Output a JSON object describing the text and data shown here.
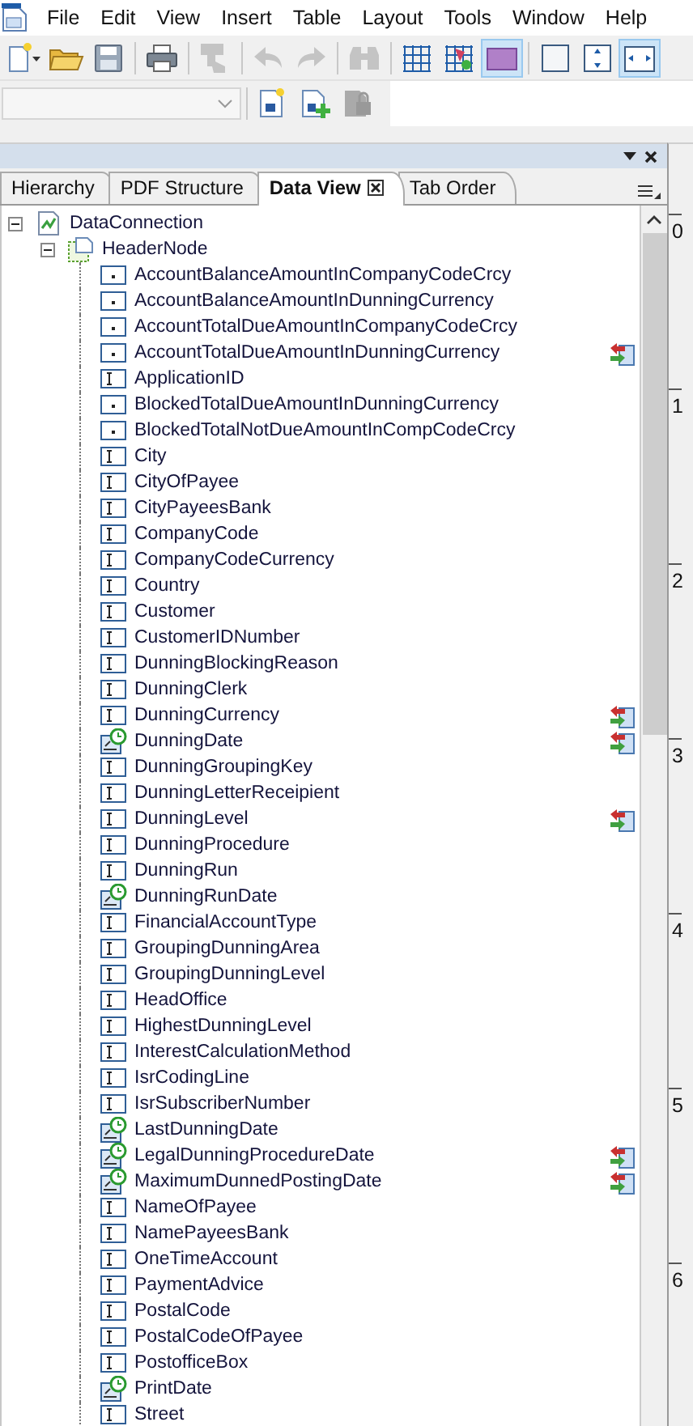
{
  "menu": [
    "File",
    "Edit",
    "View",
    "Insert",
    "Table",
    "Layout",
    "Tools",
    "Window",
    "Help"
  ],
  "toolbar": [
    {
      "kind": "new",
      "selected": false,
      "disabled": false
    },
    {
      "kind": "open",
      "selected": false,
      "disabled": false
    },
    {
      "kind": "save",
      "selected": false,
      "disabled": false
    },
    {
      "kind": "separator"
    },
    {
      "kind": "print",
      "selected": false,
      "disabled": false
    },
    {
      "kind": "separator"
    },
    {
      "kind": "painter",
      "selected": false,
      "disabled": true
    },
    {
      "kind": "separator"
    },
    {
      "kind": "undo",
      "selected": false,
      "disabled": true
    },
    {
      "kind": "redo",
      "selected": false,
      "disabled": true
    },
    {
      "kind": "separator"
    },
    {
      "kind": "find",
      "selected": false,
      "disabled": true
    },
    {
      "kind": "separator"
    },
    {
      "kind": "grid",
      "selected": false,
      "disabled": false
    },
    {
      "kind": "grid-object",
      "selected": false,
      "disabled": false
    },
    {
      "kind": "rectangle",
      "selected": true,
      "disabled": false
    },
    {
      "kind": "separator"
    },
    {
      "kind": "square",
      "selected": false,
      "disabled": false
    },
    {
      "kind": "vertical",
      "selected": false,
      "disabled": false
    },
    {
      "kind": "horizontal",
      "selected": true,
      "disabled": false
    }
  ],
  "toolbar2": [
    {
      "kind": "new-page",
      "disabled": false
    },
    {
      "kind": "add-page",
      "disabled": false
    },
    {
      "kind": "lock",
      "disabled": true
    }
  ],
  "tabs": [
    {
      "label": "Hierarchy",
      "selected": false
    },
    {
      "label": "PDF Structure",
      "selected": false
    },
    {
      "label": "Data View",
      "selected": true
    },
    {
      "label": "Tab Order",
      "selected": false
    }
  ],
  "tree": [
    {
      "label": "DataConnection",
      "kind": "connection",
      "expanded": true,
      "children": [
        {
          "label": "HeaderNode",
          "kind": "group",
          "expanded": true,
          "children": [
            {
              "label": "AccountBalanceAmountInCompanyCodeCrcy",
              "kind": "decimal",
              "bound": false
            },
            {
              "label": "AccountBalanceAmountInDunningCurrency",
              "kind": "decimal",
              "bound": false
            },
            {
              "label": "AccountTotalDueAmountInCompanyCodeCrcy",
              "kind": "decimal",
              "bound": false
            },
            {
              "label": "AccountTotalDueAmountInDunningCurrency",
              "kind": "decimal",
              "bound": true
            },
            {
              "label": "ApplicationID",
              "kind": "text",
              "bound": false
            },
            {
              "label": "BlockedTotalDueAmountInDunningCurrency",
              "kind": "decimal",
              "bound": false
            },
            {
              "label": "BlockedTotalNotDueAmountInCompCodeCrcy",
              "kind": "decimal",
              "bound": false
            },
            {
              "label": "City",
              "kind": "text",
              "bound": false
            },
            {
              "label": "CityOfPayee",
              "kind": "text",
              "bound": false
            },
            {
              "label": "CityPayeesBank",
              "kind": "text",
              "bound": false
            },
            {
              "label": "CompanyCode",
              "kind": "text",
              "bound": false
            },
            {
              "label": "CompanyCodeCurrency",
              "kind": "text",
              "bound": false
            },
            {
              "label": "Country",
              "kind": "text",
              "bound": false
            },
            {
              "label": "Customer",
              "kind": "text",
              "bound": false
            },
            {
              "label": "CustomerIDNumber",
              "kind": "text",
              "bound": false
            },
            {
              "label": "DunningBlockingReason",
              "kind": "text",
              "bound": false
            },
            {
              "label": "DunningClerk",
              "kind": "text",
              "bound": false
            },
            {
              "label": "DunningCurrency",
              "kind": "text",
              "bound": true
            },
            {
              "label": "DunningDate",
              "kind": "date",
              "bound": true
            },
            {
              "label": "DunningGroupingKey",
              "kind": "text",
              "bound": false
            },
            {
              "label": "DunningLetterReceipient",
              "kind": "text",
              "bound": false
            },
            {
              "label": "DunningLevel",
              "kind": "text",
              "bound": true
            },
            {
              "label": "DunningProcedure",
              "kind": "text",
              "bound": false
            },
            {
              "label": "DunningRun",
              "kind": "text",
              "bound": false
            },
            {
              "label": "DunningRunDate",
              "kind": "date",
              "bound": false
            },
            {
              "label": "FinancialAccountType",
              "kind": "text",
              "bound": false
            },
            {
              "label": "GroupingDunningArea",
              "kind": "text",
              "bound": false
            },
            {
              "label": "GroupingDunningLevel",
              "kind": "text",
              "bound": false
            },
            {
              "label": "HeadOffice",
              "kind": "text",
              "bound": false
            },
            {
              "label": "HighestDunningLevel",
              "kind": "text",
              "bound": false
            },
            {
              "label": "InterestCalculationMethod",
              "kind": "text",
              "bound": false
            },
            {
              "label": "IsrCodingLine",
              "kind": "text",
              "bound": false
            },
            {
              "label": "IsrSubscriberNumber",
              "kind": "text",
              "bound": false
            },
            {
              "label": "LastDunningDate",
              "kind": "date",
              "bound": false
            },
            {
              "label": "LegalDunningProcedureDate",
              "kind": "date",
              "bound": true
            },
            {
              "label": "MaximumDunnedPostingDate",
              "kind": "date",
              "bound": true
            },
            {
              "label": "NameOfPayee",
              "kind": "text",
              "bound": false
            },
            {
              "label": "NamePayeesBank",
              "kind": "text",
              "bound": false
            },
            {
              "label": "OneTimeAccount",
              "kind": "text",
              "bound": false
            },
            {
              "label": "PaymentAdvice",
              "kind": "text",
              "bound": false
            },
            {
              "label": "PostalCode",
              "kind": "text",
              "bound": false
            },
            {
              "label": "PostalCodeOfPayee",
              "kind": "text",
              "bound": false
            },
            {
              "label": "PostofficeBox",
              "kind": "text",
              "bound": false
            },
            {
              "label": "PrintDate",
              "kind": "date",
              "bound": false
            },
            {
              "label": "Street",
              "kind": "text",
              "bound": false
            }
          ]
        }
      ]
    }
  ],
  "ruler": [
    "0",
    "1",
    "2",
    "3",
    "4",
    "5",
    "6"
  ]
}
